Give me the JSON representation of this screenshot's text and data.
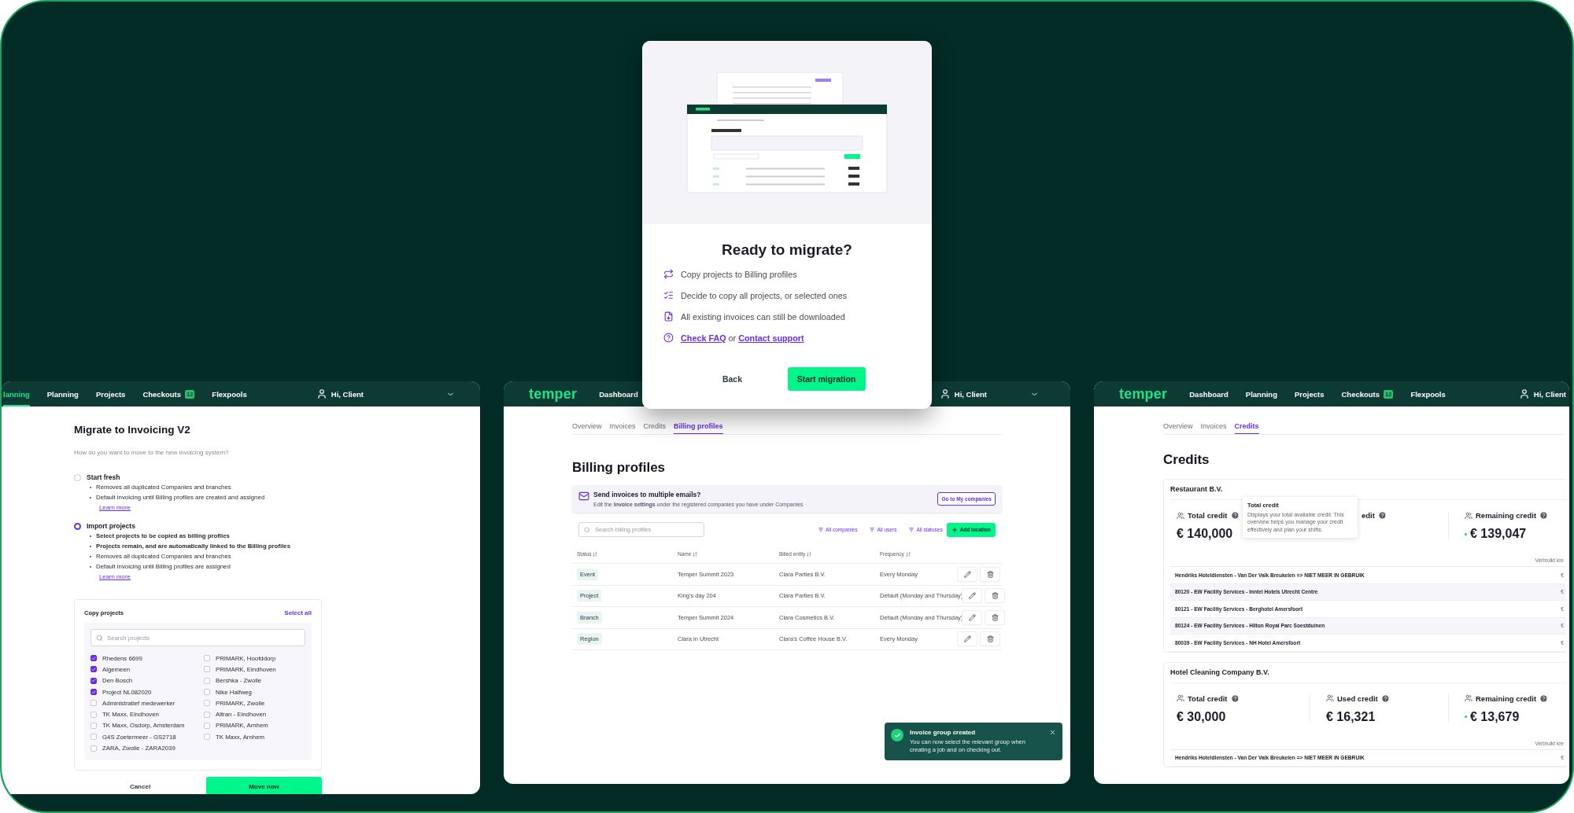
{
  "left_window": {
    "nav": [
      {
        "label": "lanning",
        "selected": true
      },
      {
        "label": "Planning",
        "selected": false
      },
      {
        "label": "Projects",
        "selected": false
      },
      {
        "label": "Checkouts",
        "selected": false,
        "badge": "12"
      },
      {
        "label": "Flexpools",
        "selected": false
      }
    ],
    "user": "Hi, Client",
    "title": "Migrate to Invoicing V2",
    "subtitle": "How do you want to move to the new invoicing system?",
    "options": [
      {
        "label": "Start fresh",
        "selected": false,
        "bullets": [
          {
            "text": "Removes all duplicated Companies and branches",
            "bold": false
          },
          {
            "text": "Default invoicing until Billing profiles are created and assigned",
            "bold": false
          }
        ],
        "link": "Learn more"
      },
      {
        "label": "Import projects",
        "selected": true,
        "bullets": [
          {
            "text": "Select projects to be copied as billing profiles",
            "bold": true
          },
          {
            "text": "Projects remain, and are automatically linked to the Billing profiles",
            "bold": true
          },
          {
            "text": "Removes all duplicated Companies and branches",
            "bold": false
          },
          {
            "text": "Default invoicing until Billing profiles are assigned",
            "bold": false
          }
        ],
        "link": "Learn more"
      }
    ],
    "copy_projects": {
      "title": "Copy projects",
      "select_all": "Select all",
      "search": {
        "placeholder": "Search projects"
      },
      "projects": [
        {
          "label": "Rhedens 6699",
          "checked": true
        },
        {
          "label": "Algemeen",
          "checked": true
        },
        {
          "label": "Den Bosch",
          "checked": true
        },
        {
          "label": "Project NL082020",
          "checked": true
        },
        {
          "label": "Administratief medewerker",
          "checked": false
        },
        {
          "label": "TK Maxx, Eindhoven",
          "checked": false
        },
        {
          "label": "TK Maxx, Osdorp, Amsterdam",
          "checked": false
        },
        {
          "label": "G4S Zoetermeer - GS2718",
          "checked": false
        },
        {
          "label": "ZARA, Zwolle - ZARA2039",
          "checked": false
        },
        {
          "label": "PRIMARK, Hoofddorp",
          "checked": false
        },
        {
          "label": "PRIMARK, Eindhoven",
          "checked": false
        },
        {
          "label": "Bershka - Zwolle",
          "checked": false
        },
        {
          "label": "Nike Halfweg",
          "checked": false
        },
        {
          "label": "PRIMARK, Zwolle",
          "checked": false
        },
        {
          "label": "Altran - Eindhoven",
          "checked": false
        },
        {
          "label": "PRIMARK, Arnhem",
          "checked": false
        },
        {
          "label": "TK Maxx, Arnhem",
          "checked": false
        }
      ]
    },
    "buttons": [
      {
        "label": "Cancel",
        "kind": "text"
      },
      {
        "label": "Move now",
        "kind": "primary"
      }
    ]
  },
  "middle_window": {
    "logo": "temper",
    "nav": [
      {
        "label": "Dashboard",
        "selected": false
      }
    ],
    "user": "Hi, Client",
    "tabs": [
      {
        "label": "Overview",
        "selected": false
      },
      {
        "label": "Invoices",
        "selected": false
      },
      {
        "label": "Credits",
        "selected": false
      },
      {
        "label": "Billing profiles",
        "selected": true
      }
    ],
    "title": "Billing profiles",
    "banner": {
      "title": "Send invoices to multiple emails?",
      "text": "Edit the **Invoice settings** under the registered companies you have under Companies",
      "button": "Go to My companies"
    },
    "search": {
      "placeholder": "Search billing profiles"
    },
    "filters": [
      "All companies",
      "All users",
      "All statuses"
    ],
    "add_button": "Add location",
    "table": {
      "columns": [
        "Status",
        "Name",
        "Billed entity",
        "Frequency"
      ],
      "rows": [
        {
          "status": "Event",
          "name": "Temper Summit 2023",
          "billed_entity": "Clara Parties B.V.",
          "frequency": "Every Monday"
        },
        {
          "status": "Project",
          "name": "King's day 204",
          "billed_entity": "Clara Parties B.V.",
          "frequency": "Default (Monday and Thursday)"
        },
        {
          "status": "Branch",
          "name": "Temper Summit 2024",
          "billed_entity": "Clara Cosmetics B.V.",
          "frequency": "Default (Monday and Thursday)"
        },
        {
          "status": "Region",
          "name": "Clara in Utrecht",
          "billed_entity": "Clara's Coffee House B.V.",
          "frequency": "Every Monday"
        }
      ]
    },
    "toast": {
      "title": "Invoice group created",
      "text": "You can now select the relevant group when creating a job and on checking out."
    }
  },
  "right_window": {
    "logo": "temper",
    "nav": [
      {
        "label": "Dashboard",
        "selected": false
      },
      {
        "label": "Planning",
        "selected": false
      },
      {
        "label": "Projects",
        "selected": false
      },
      {
        "label": "Checkouts",
        "selected": false,
        "badge": "12"
      },
      {
        "label": "Flexpools",
        "selected": false
      }
    ],
    "user": "Hi, Client",
    "tabs": [
      {
        "label": "Overview",
        "selected": false
      },
      {
        "label": "Invoices",
        "selected": false
      },
      {
        "label": "Credits",
        "selected": true
      }
    ],
    "title": "Credits",
    "companies": [
      {
        "name": "Restaurant B.V.",
        "stats": [
          {
            "kind": "plain",
            "label": "Total credit",
            "value": "€ 140,000"
          },
          {
            "kind": "covered",
            "label": "edit"
          },
          {
            "kind": "remaining",
            "label": "Remaining credit",
            "value": "€ 139,047"
          }
        ],
        "column_header": "Verbruikt kre",
        "rows": [
          {
            "name": "Hendriks Hoteldiensten - Van Der Valk Breukelen => NIET MEER IN GEBRUIK",
            "amount": "€"
          },
          {
            "name": "80120 - EW Facility Services - Inntel Hotels Utrecht Centre",
            "amount": "€"
          },
          {
            "name": "80121 - EW Facility Services - Berghotel Amersfoort",
            "amount": "€"
          },
          {
            "name": "80124 - EW Facility Services - Hilton Royal  Parc Soestduinen",
            "amount": "€"
          },
          {
            "name": "80039 - EW Facility Services - NH Hotel Amersfoort",
            "amount": "€"
          }
        ],
        "tooltip": {
          "title": "Total credit",
          "text": "Displays your total available credit. This overview helps you manage your credit effectively and plan your shifts."
        }
      },
      {
        "name": "Hotel Cleaning Company B.V.",
        "stats": [
          {
            "kind": "plain",
            "label": "Total credit",
            "value": "€ 30,000"
          },
          {
            "kind": "plain",
            "label": "Used credit",
            "value": "€ 16,321"
          },
          {
            "kind": "remaining",
            "label": "Remaining credit",
            "value": "€ 13,679"
          }
        ],
        "column_header": "Verbruikt kre",
        "rows": [
          {
            "name": "Hendriks Hoteldiensten - Van Der Valk Breukelen => NIET MEER IN GEBRUIK",
            "amount": "€"
          }
        ]
      }
    ]
  },
  "modal": {
    "title": "Ready to migrate?",
    "items": [
      {
        "kind": "sync",
        "text": "Copy projects to Billing profiles"
      },
      {
        "kind": "checklist",
        "text": "Decide to copy all projects, or selected ones"
      },
      {
        "kind": "download",
        "text": "All existing invoices can still be downloaded"
      },
      {
        "kind": "help",
        "links": [
          "Check FAQ",
          "Contact support"
        ],
        "joiner": "or"
      }
    ],
    "buttons": [
      {
        "label": "Back",
        "kind": "text"
      },
      {
        "label": "Start migration",
        "kind": "primary"
      }
    ]
  }
}
